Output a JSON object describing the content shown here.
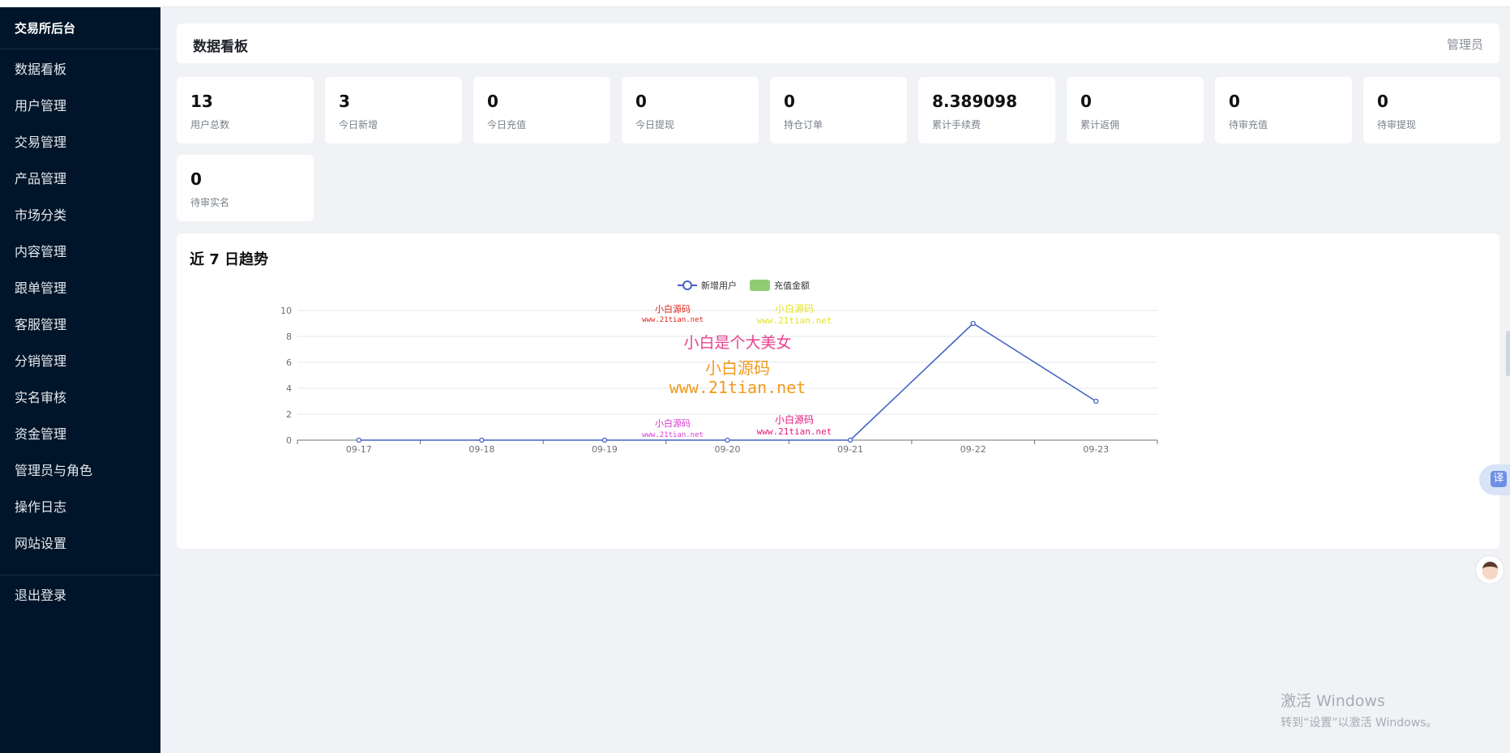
{
  "sidebar": {
    "brand": "交易所后台",
    "items": [
      {
        "label": "数据看板"
      },
      {
        "label": "用户管理"
      },
      {
        "label": "交易管理"
      },
      {
        "label": "产品管理"
      },
      {
        "label": "市场分类"
      },
      {
        "label": "内容管理"
      },
      {
        "label": "跟单管理"
      },
      {
        "label": "客服管理"
      },
      {
        "label": "分销管理"
      },
      {
        "label": "实名审核"
      },
      {
        "label": "资金管理"
      },
      {
        "label": "管理员与角色"
      },
      {
        "label": "操作日志"
      },
      {
        "label": "网站设置"
      }
    ],
    "logout": "退出登录"
  },
  "header": {
    "title": "数据看板",
    "role": "管理员"
  },
  "stats": [
    {
      "value": "13",
      "label": "用户总数"
    },
    {
      "value": "3",
      "label": "今日新增"
    },
    {
      "value": "0",
      "label": "今日充值"
    },
    {
      "value": "0",
      "label": "今日提现"
    },
    {
      "value": "0",
      "label": "持仓订单"
    },
    {
      "value": "8.389098",
      "label": "累计手续费"
    },
    {
      "value": "0",
      "label": "累计返佣"
    },
    {
      "value": "0",
      "label": "待审充值"
    },
    {
      "value": "0",
      "label": "待审提现"
    },
    {
      "value": "0",
      "label": "待审实名"
    }
  ],
  "chart_title": "近 7 日趋势",
  "chart_data": {
    "type": "line",
    "categories": [
      "09-17",
      "09-18",
      "09-19",
      "09-20",
      "09-21",
      "09-22",
      "09-23"
    ],
    "series": [
      {
        "name": "新增用户",
        "type": "line",
        "color": "#4463c4",
        "values": [
          0,
          0,
          0,
          0,
          0,
          9,
          3
        ]
      },
      {
        "name": "充值金额",
        "type": "bar",
        "color": "#91cc75",
        "values": [
          0,
          0,
          0,
          0,
          0,
          0,
          0
        ]
      }
    ],
    "yticks": [
      0,
      2,
      4,
      6,
      8,
      10
    ],
    "ylim": [
      0,
      10
    ],
    "grid": true,
    "legend": "top-center"
  },
  "overlay": {
    "watermark_lines": [
      "小白源码",
      "www.21tian.net",
      "小白是个大美女"
    ],
    "translate_label": "译",
    "windows_activation": [
      "激活 Windows",
      "转到“设置”以激活 Windows。"
    ]
  }
}
